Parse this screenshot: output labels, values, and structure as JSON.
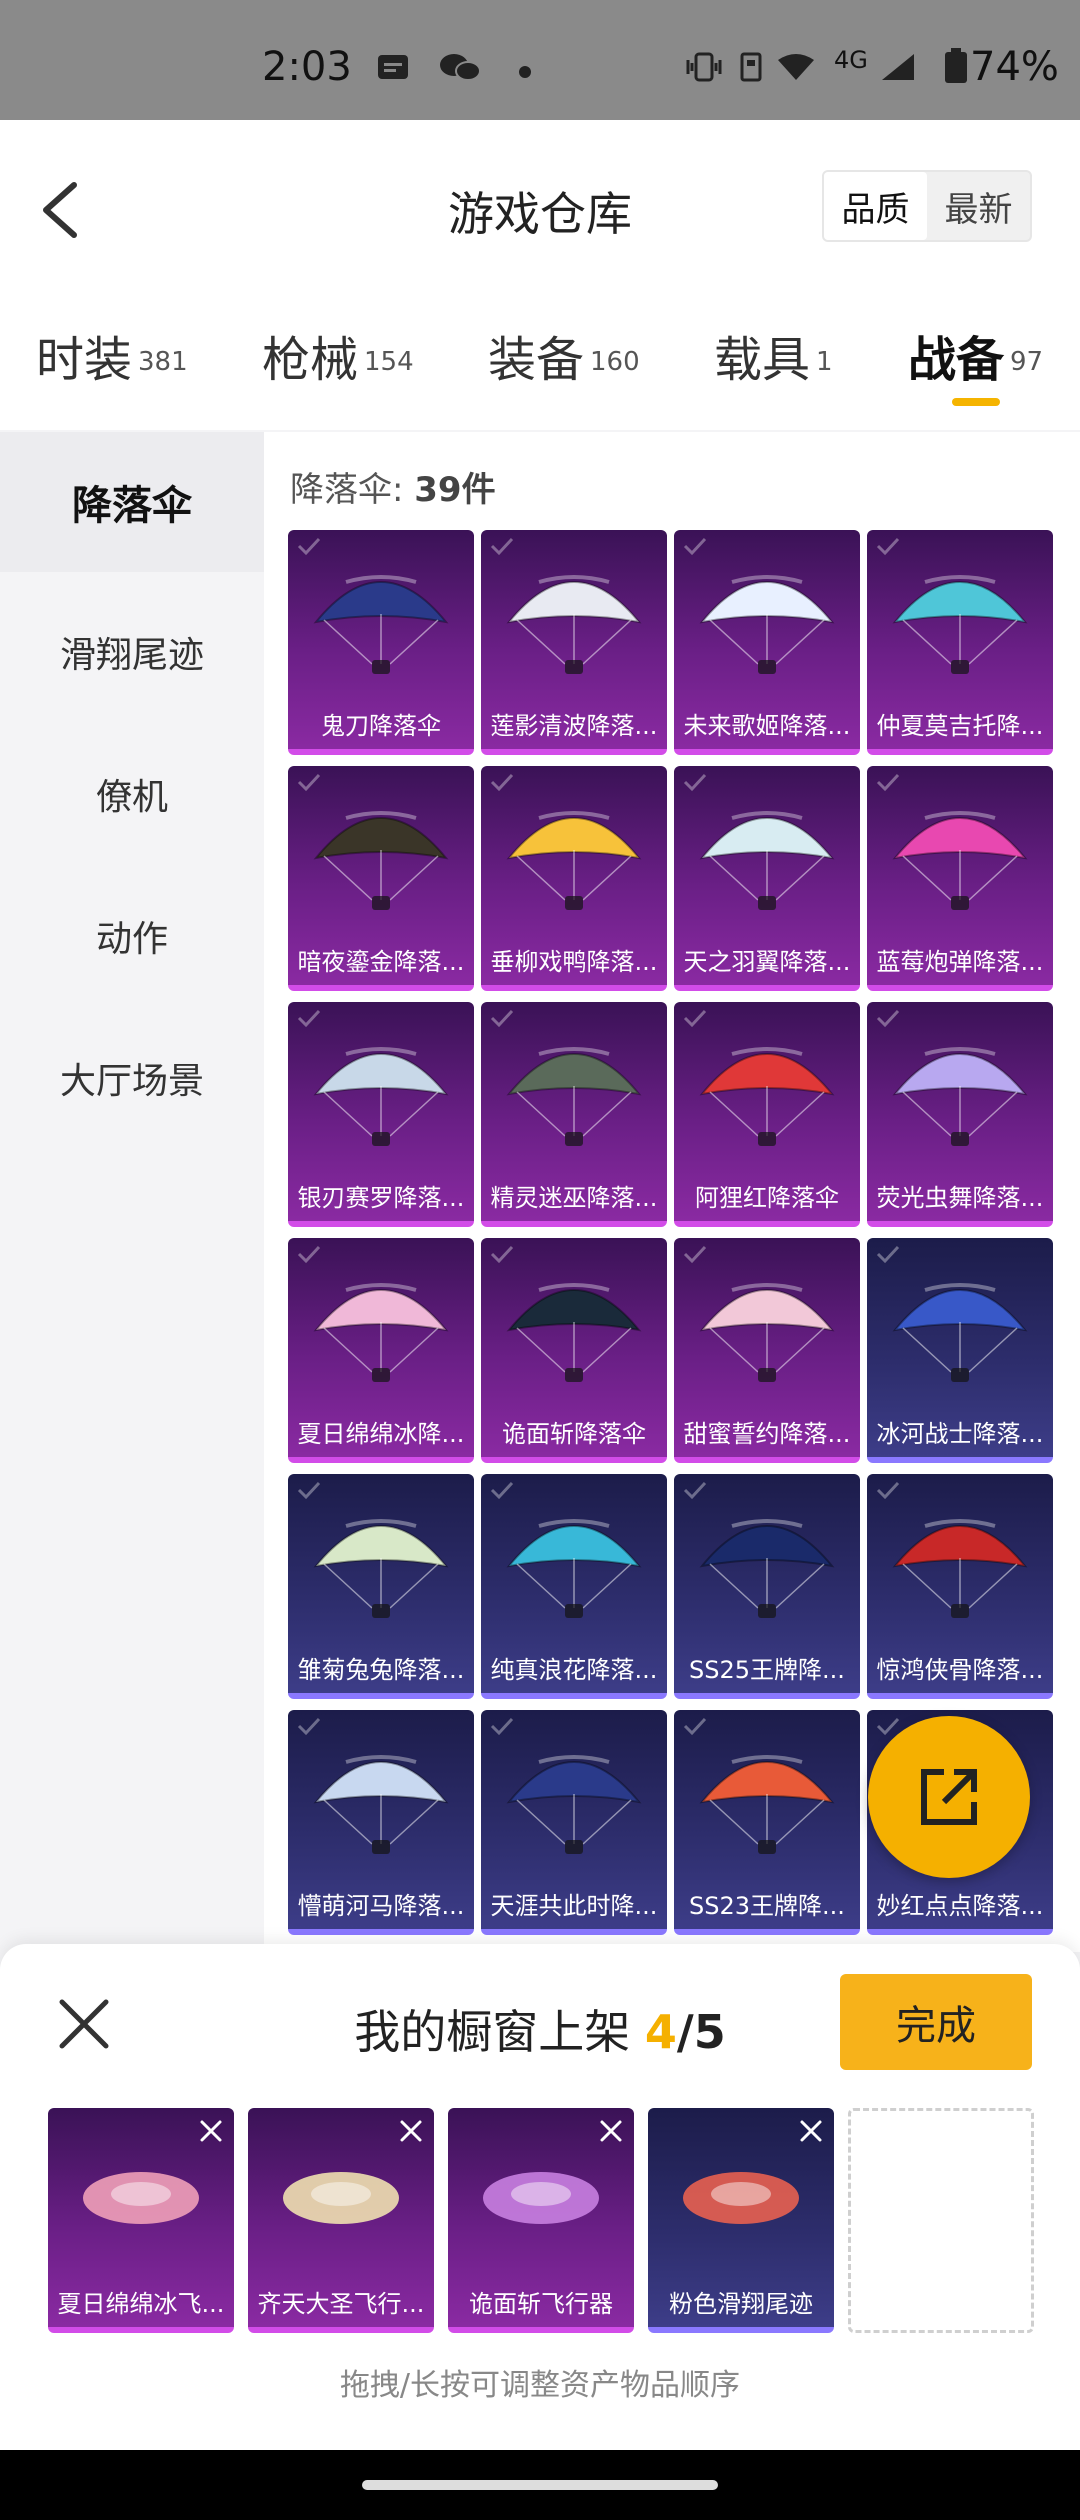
{
  "status_bar": {
    "time": "2:03",
    "network": "4G",
    "battery": "74%"
  },
  "header": {
    "title": "游戏仓库",
    "sort_options": [
      "品质",
      "最新"
    ],
    "sort_selected": "品质"
  },
  "tabs": [
    {
      "label": "时装",
      "count": "381"
    },
    {
      "label": "枪械",
      "count": "154"
    },
    {
      "label": "装备",
      "count": "160"
    },
    {
      "label": "载具",
      "count": "1"
    },
    {
      "label": "战备",
      "count": "97",
      "active": true
    }
  ],
  "sidebar": {
    "items": [
      {
        "label": "降落伞",
        "active": true
      },
      {
        "label": "滑翔尾迹"
      },
      {
        "label": "僚机"
      },
      {
        "label": "动作"
      },
      {
        "label": "大厅场景"
      }
    ]
  },
  "content": {
    "count_label": "降落伞: ",
    "count_value": "39件",
    "items": [
      {
        "name": "鬼刀降落伞",
        "tier": "purple",
        "color": "#2a3a8a"
      },
      {
        "name": "莲影清波降落...",
        "tier": "purple",
        "color": "#e8eaf2"
      },
      {
        "name": "未来歌姬降落...",
        "tier": "purple",
        "color": "#e8f0ff"
      },
      {
        "name": "仲夏莫吉托降...",
        "tier": "purple",
        "color": "#4fc6d8"
      },
      {
        "name": "暗夜鎏金降落...",
        "tier": "purple",
        "color": "#3a3528"
      },
      {
        "name": "垂柳戏鸭降落...",
        "tier": "purple",
        "color": "#f7c23a"
      },
      {
        "name": "天之羽翼降落...",
        "tier": "purple",
        "color": "#d8ecf2"
      },
      {
        "name": "蓝莓炮弹降落...",
        "tier": "purple",
        "color": "#e848b0"
      },
      {
        "name": "银刃赛罗降落...",
        "tier": "purple",
        "color": "#c8d8e8"
      },
      {
        "name": "精灵迷巫降落...",
        "tier": "purple",
        "color": "#5a6a5a"
      },
      {
        "name": "阿狸红降落伞",
        "tier": "purple",
        "color": "#e03838"
      },
      {
        "name": "荧光虫舞降落...",
        "tier": "purple",
        "color": "#b8a8f0"
      },
      {
        "name": "夏日绵绵冰降...",
        "tier": "purple",
        "color": "#f0b8d8"
      },
      {
        "name": "诡面斩降落伞",
        "tier": "purple",
        "color": "#1a2a3a"
      },
      {
        "name": "甜蜜誓约降落...",
        "tier": "purple",
        "color": "#f2c8d8"
      },
      {
        "name": "冰河战士降落...",
        "tier": "blue",
        "color": "#3858c8"
      },
      {
        "name": "雏菊兔兔降落...",
        "tier": "blue",
        "color": "#d8e8c8"
      },
      {
        "name": "纯真浪花降落...",
        "tier": "blue",
        "color": "#38b8d8"
      },
      {
        "name": "SS25王牌降...",
        "tier": "blue",
        "color": "#1a2a6a"
      },
      {
        "name": "惊鸿侠骨降落...",
        "tier": "blue",
        "color": "#c82828"
      },
      {
        "name": "懵萌河马降落...",
        "tier": "blue",
        "color": "#c8d8f0"
      },
      {
        "name": "天涯共此时降...",
        "tier": "blue",
        "color": "#2a3a8a"
      },
      {
        "name": "SS23王牌降...",
        "tier": "blue",
        "color": "#e85a38"
      },
      {
        "name": "妙红点点降落...",
        "tier": "blue",
        "color": "#c8c8d8"
      }
    ]
  },
  "showcase": {
    "title_prefix": "我的橱窗上架 ",
    "current": "4",
    "separator": "/",
    "total": "5",
    "done_label": "完成",
    "slots": [
      {
        "name": "夏日绵绵冰飞...",
        "tier": "purple",
        "color": "#f0a0b8"
      },
      {
        "name": "齐天大圣飞行...",
        "tier": "purple",
        "color": "#f0e0b0"
      },
      {
        "name": "诡面斩飞行器",
        "tier": "purple",
        "color": "#c880e0"
      },
      {
        "name": "粉色滑翔尾迹",
        "tier": "blue",
        "color": "#e86050"
      }
    ],
    "hint": "拖拽/长按可调整资产物品顺序"
  },
  "colors": {
    "accent": "#f5b000",
    "purple_tier": "#8a2aa2",
    "blue_tier": "#3d3d88"
  }
}
